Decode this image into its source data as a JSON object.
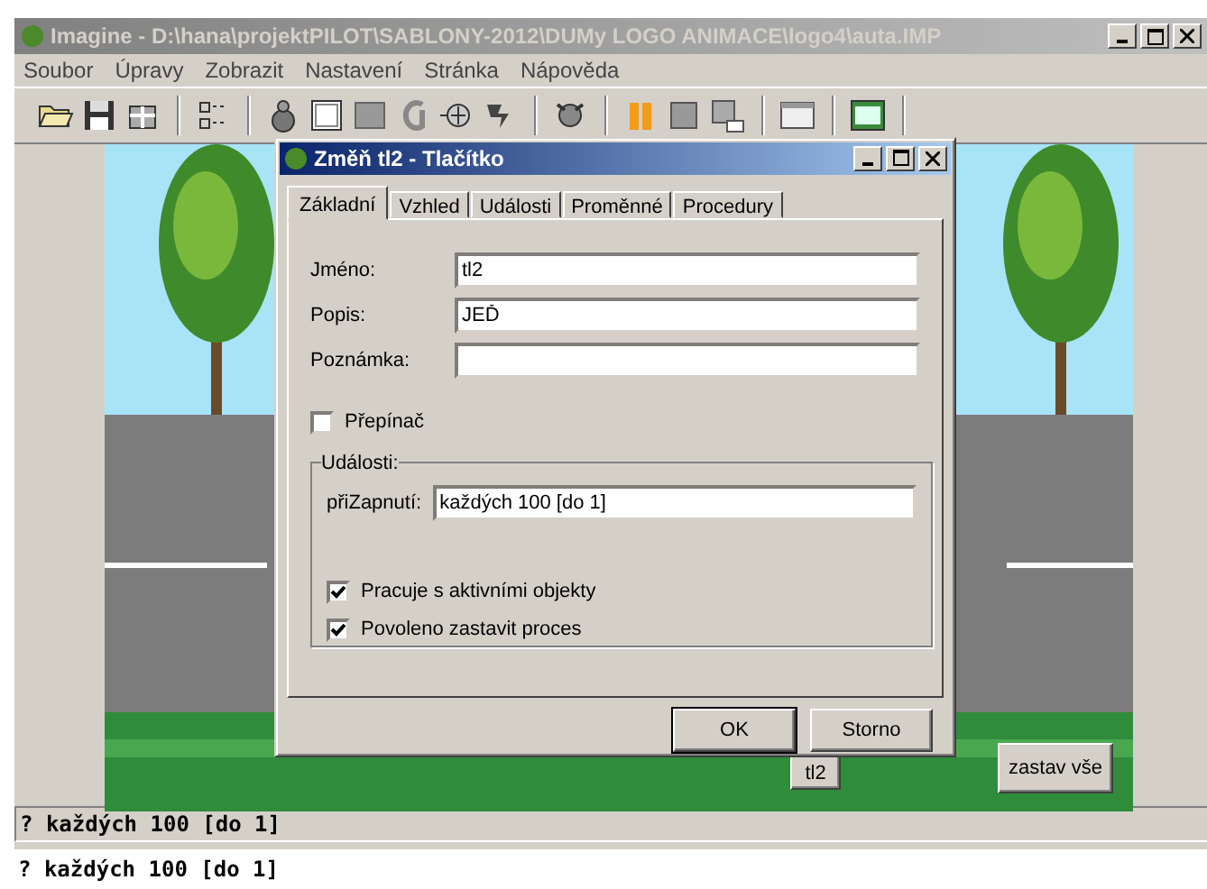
{
  "window": {
    "title": "Imagine - D:\\hana\\projektPILOT\\SABLONY-2012\\DUMy LOGO ANIMACE\\logo4\\auta.IMP"
  },
  "menu": [
    "Soubor",
    "Úpravy",
    "Zobrazit",
    "Nastavení",
    "Stránka",
    "Nápověda"
  ],
  "canvas": {
    "buttons": [
      {
        "label": "tl2"
      },
      {
        "label": "zastav vše"
      }
    ]
  },
  "dialog": {
    "title": "Změň tl2  - Tlačítko",
    "tabs": [
      {
        "label": "Základní",
        "selected": true
      },
      {
        "label": "Vzhled",
        "selected": false
      },
      {
        "label": "Události",
        "selected": false
      },
      {
        "label": "Proměnné",
        "selected": false
      },
      {
        "label": "Procedury",
        "selected": false
      }
    ],
    "fields": [
      {
        "label": "Jméno:",
        "value": "tl2"
      },
      {
        "label": "Popis:",
        "value": "JEĎ"
      },
      {
        "label": "Poznámka:"
      }
    ],
    "toggle": {
      "label": "Přepínač",
      "checked": false
    },
    "events": {
      "title": "Události:",
      "label": "přiZapnutí:",
      "value": "každých 100 [do 1]"
    },
    "options": [
      {
        "label": "Pracuje s aktivními objekty",
        "checked": true
      },
      {
        "label": "Povoleno zastavit proces",
        "checked": true
      }
    ],
    "buttons": [
      "OK",
      "Storno"
    ]
  },
  "command_line": {
    "value": "? každých 100 [do 1]"
  },
  "output": {
    "text": "? každých 100 [do 1]"
  }
}
